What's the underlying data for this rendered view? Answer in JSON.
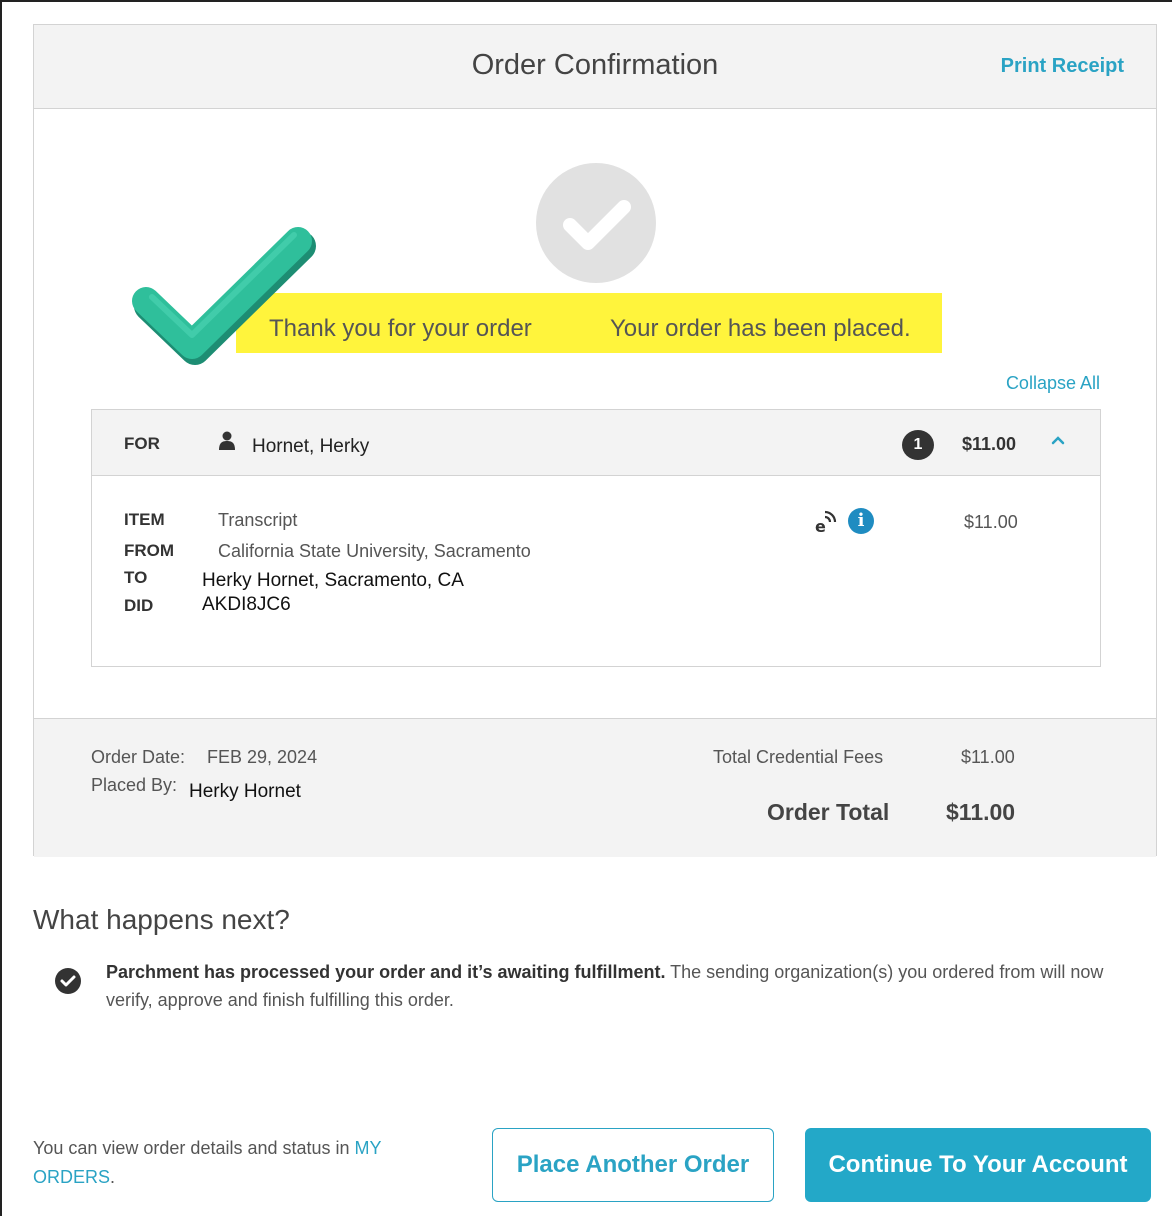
{
  "header": {
    "title": "Order Confirmation",
    "print_receipt": "Print Receipt"
  },
  "confirmation": {
    "thanks": "Thank you for your order",
    "placed": "Your order has been placed."
  },
  "collapse_all": "Collapse All",
  "recipient": {
    "for_label": "FOR",
    "name": "Hornet, Herky",
    "item_count": "1",
    "total": "$11.00"
  },
  "item": {
    "item_label": "ITEM",
    "item_value": "Transcript",
    "from_label": "FROM",
    "from_value": "California State University, Sacramento",
    "to_label": "TO",
    "to_value": "Herky Hornet, Sacramento, CA",
    "did_label": "DID",
    "did_value": "AKDI8JC6",
    "price": "$11.00"
  },
  "summary": {
    "order_date_label": "Order Date:",
    "order_date": "FEB 29, 2024",
    "placed_by_label": "Placed By:",
    "placed_by": "Herky Hornet",
    "credential_fees_label": "Total Credential Fees",
    "credential_fees": "$11.00",
    "order_total_label": "Order Total",
    "order_total": "$11.00"
  },
  "next": {
    "title": "What happens next?",
    "bold": "Parchment has processed your order and it’s awaiting fulfillment.",
    "text": " The sending organization(s) you ordered from will now verify, approve and finish fulfilling this order."
  },
  "footer": {
    "view_text": "You can view order details and status in ",
    "my_orders": "MY ORDERS",
    "period": ".",
    "place_another": "Place Another Order",
    "continue": "Continue To Your Account"
  },
  "colors": {
    "accent": "#2aa3c4",
    "primary_button": "#23a8c8",
    "highlight": "#fff43c",
    "check_green": "#2fbf9b"
  },
  "icons": [
    "checkmark-circle-icon",
    "checkmark-icon",
    "person-icon",
    "chevron-up-icon",
    "e-delivery-icon",
    "info-icon",
    "check-circle-icon"
  ]
}
